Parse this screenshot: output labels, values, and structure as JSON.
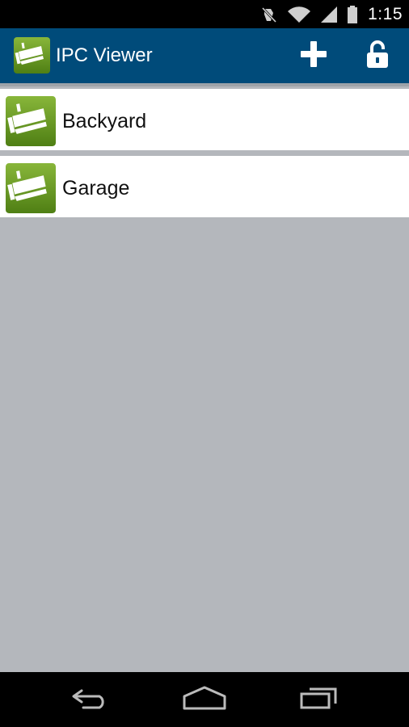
{
  "status_bar": {
    "time": "1:15",
    "icons": [
      "mute-icon",
      "wifi-icon",
      "signal-icon",
      "battery-icon"
    ]
  },
  "action_bar": {
    "title": "IPC Viewer",
    "background": "#004b7a",
    "actions": [
      {
        "icon": "add-icon"
      },
      {
        "icon": "lock-open-icon"
      }
    ]
  },
  "cameras": [
    {
      "label": "Backyard",
      "icon": "camera-icon"
    },
    {
      "label": "Garage",
      "icon": "camera-icon"
    }
  ],
  "colors": {
    "icon_green": "#6a9a1f",
    "list_background": "#b4b7bc"
  },
  "nav_bar": {
    "buttons": [
      "back-icon",
      "home-icon",
      "recents-icon"
    ]
  }
}
